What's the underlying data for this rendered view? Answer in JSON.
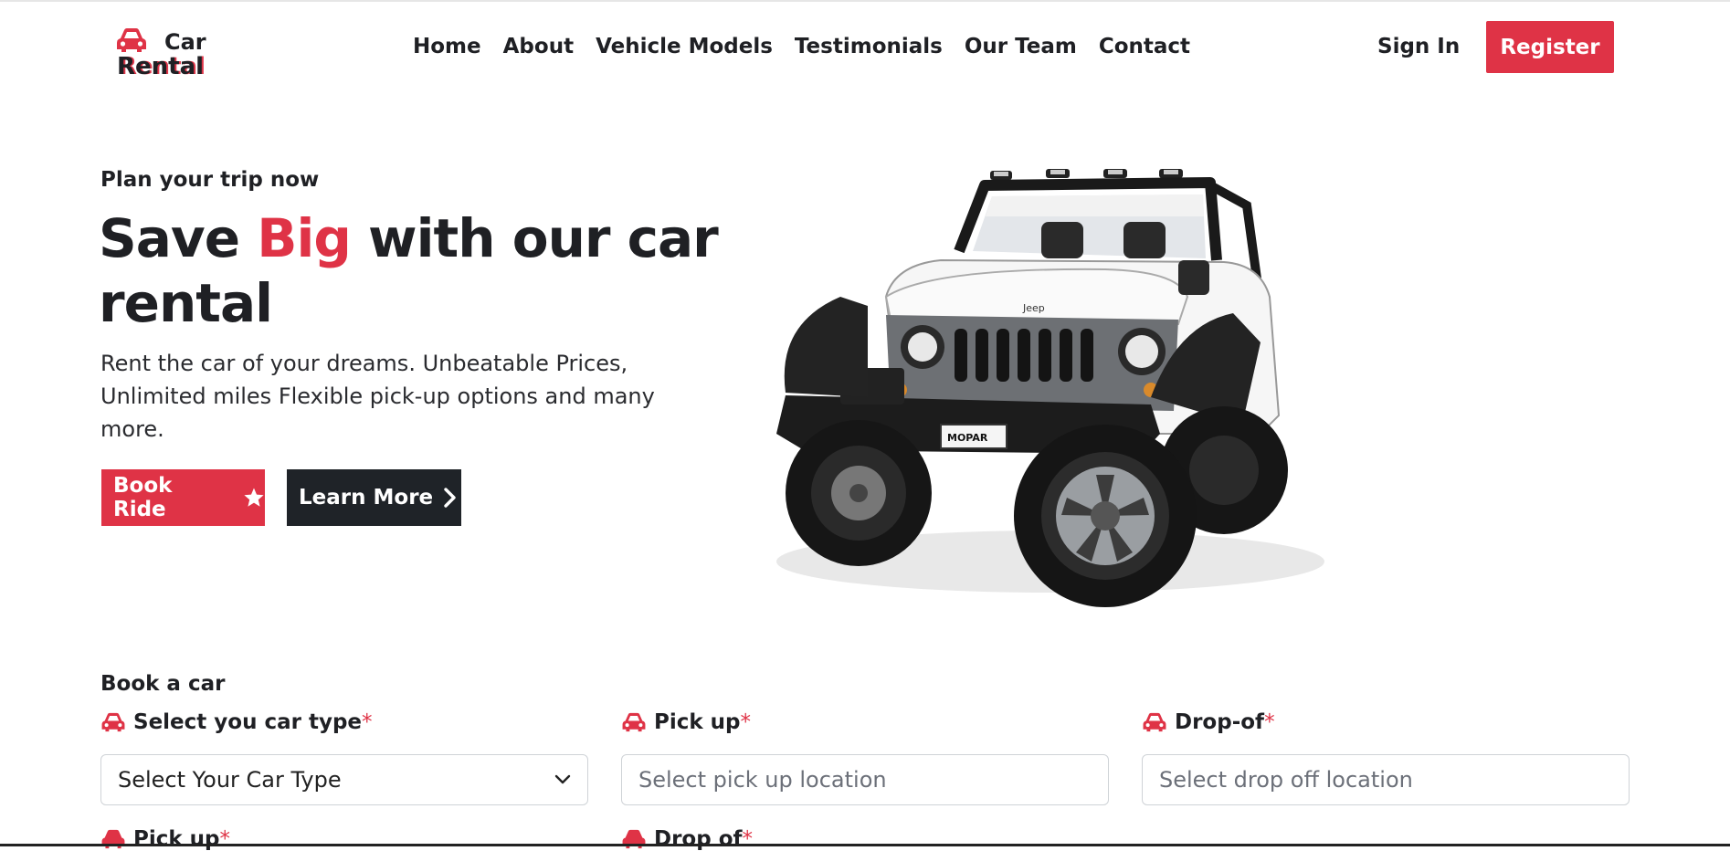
{
  "logo": {
    "line1": "Car",
    "line2": "Rental"
  },
  "nav": {
    "items": [
      "Home",
      "About",
      "Vehicle Models",
      "Testimonials",
      "Our Team",
      "Contact"
    ],
    "sign_in": "Sign In",
    "register": "Register"
  },
  "hero": {
    "eyebrow": "Plan your trip now",
    "headline_pre": "Save ",
    "headline_highlight": "Big",
    "headline_post": " with our car rental",
    "lead": "Rent the car of your dreams. Unbeatable Prices, Unlimited miles Flexible pick-up options and many more.",
    "book_button": "Book Ride",
    "learn_button": "Learn More",
    "image_text": {
      "grille_badge": "Jeep",
      "plate": "MOPAR"
    }
  },
  "booking": {
    "title": "Book a car",
    "car_type": {
      "label": "Select you car type",
      "required": "*",
      "value": "Select Your Car Type"
    },
    "pickup": {
      "label": "Pick up",
      "required": "*",
      "placeholder": "Select pick up location"
    },
    "dropoff": {
      "label": "Drop-of",
      "required": "*",
      "placeholder": "Select drop off location"
    },
    "row2": {
      "pickup_date_label": "Pick up",
      "dropoff_date_label": "Drop of",
      "required": "*"
    }
  },
  "colors": {
    "accent": "#df3346",
    "dark": "#1f2328",
    "text": "#1f2024"
  }
}
